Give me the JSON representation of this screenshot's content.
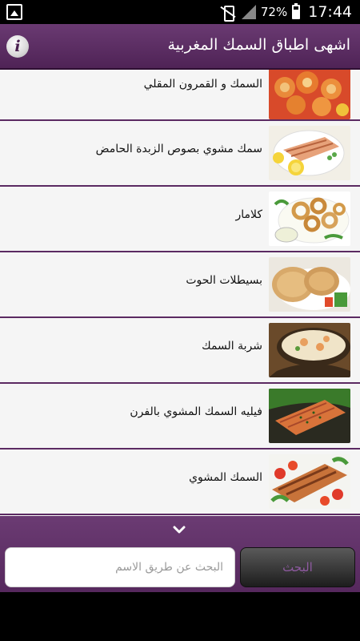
{
  "status_bar": {
    "battery_percent": "72%",
    "time": "17:44",
    "icons": [
      "image-notification-icon",
      "vibrate-icon",
      "signal-icon",
      "battery-icon"
    ]
  },
  "header": {
    "title": "اشهى اطباق السمك المغربية",
    "info_icon": "info-icon",
    "background": "#5e2d65"
  },
  "recipes": [
    {
      "label": "السمك و القمرون المقلي"
    },
    {
      "label": "سمك مشوي بصوص الزبدة الحامض"
    },
    {
      "label": "كلامار"
    },
    {
      "label": "بسيطلات الحوت"
    },
    {
      "label": "شربة السمك"
    },
    {
      "label": "فيليه السمك المشوي بالفرن"
    },
    {
      "label": "السمك المشوي"
    }
  ],
  "bottom": {
    "expand_icon": "chevron-down-icon",
    "search_placeholder": "البحث عن طريق الاسم",
    "search_value": "",
    "search_button_label": "البحث"
  }
}
